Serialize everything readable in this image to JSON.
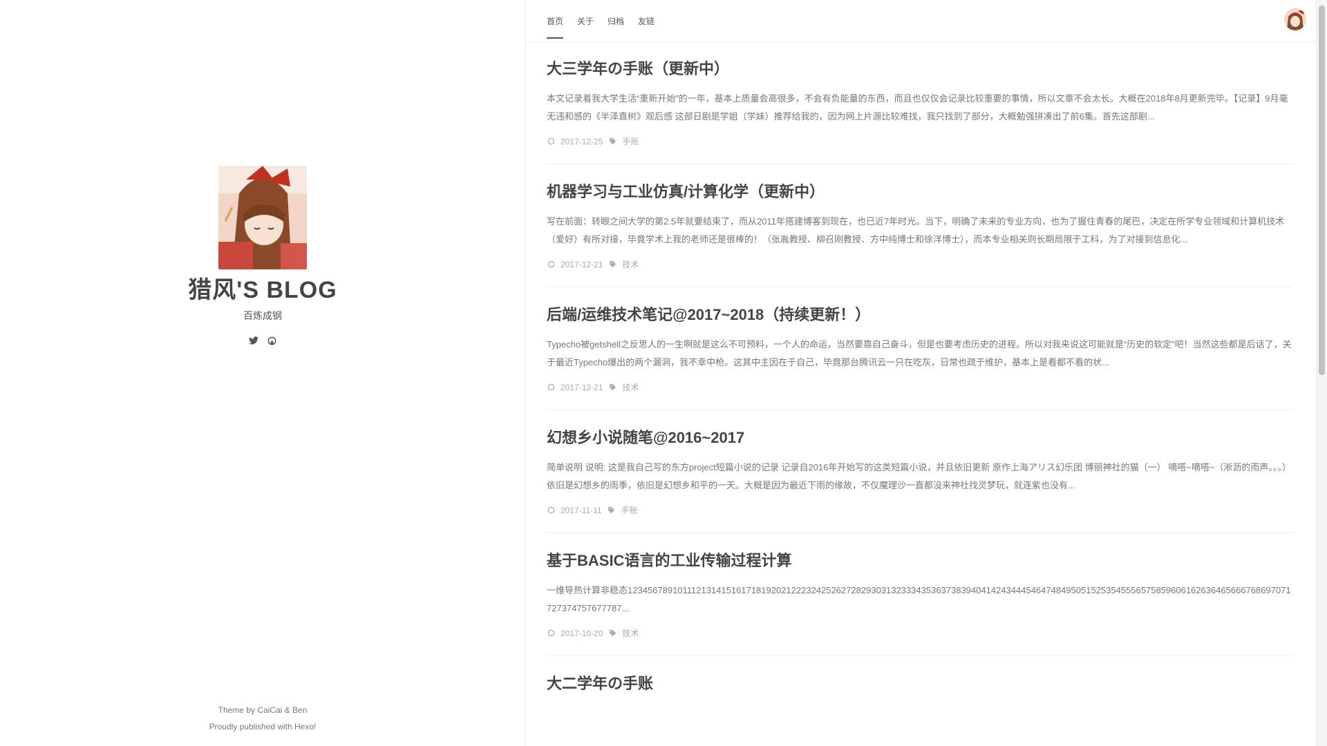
{
  "sidebar": {
    "title": "猎风'S BLOG",
    "subtitle": "百炼成钢",
    "social_icons": [
      "twitter-icon",
      "github-icon"
    ],
    "footer": {
      "line1": "Theme by CaiCai & Ben",
      "line2": "Proudly published with Hexo!"
    }
  },
  "nav": {
    "items": [
      {
        "label": "首页",
        "active": true
      },
      {
        "label": "关于"
      },
      {
        "label": "归档"
      },
      {
        "label": "友链"
      }
    ]
  },
  "posts": [
    {
      "title": "大三学年の手账（更新中）",
      "excerpt": "本文记录着我大学生活“重新开始”的一年，基本上质量会高很多，不会有负能量的东西，而且也仅仅会记录比较重要的事情，所以文章不会太长。大概在2018年8月更新完毕。【记录】9月毫无违和感的《半泽直树》观后感 这部日剧是学姐（学妹）推荐给我的，因为网上片源比较难找，我只找到了部分，大概勉强拼凑出了前6集。首先这部剧...",
      "date": "2017-12-25",
      "tag": "手账"
    },
    {
      "title": "机器学习与工业仿真/计算化学（更新中）",
      "excerpt": "写在前面：转眼之间大学的第2.5年就要结束了，而从2011年搭建博客到现在，也已近7年时光。当下，明确了未来的专业方向，也为了握住青春的尾巴，决定在所学专业领域和计算机技术（爱好）有所对接，毕竟学术上我的老师还是很棒的！（张胤教授、柳召刚教授、方中纯博士和徐洋博士），而本专业相关则长期局限于工科，为了对接到信息化...",
      "date": "2017-12-21",
      "tag": "技术"
    },
    {
      "title": "后端/运维技术笔记@2017~2018（持续更新！）",
      "excerpt": "Typecho被getshell之反思人的一生啊就是这么不可预料，一个人的命运，当然要靠自己奋斗，但是也要考虑历史的进程。所以对我来说这可能就是“历史的软定”吧！当然这些都是后话了，关于最近Typecho爆出的两个漏洞，我不幸中枪。这其中主因在于自己，毕竟那台腾讯云一只在吃灰，日常也疏于维护，基本上是看都不看的状...",
      "date": "2017-12-21",
      "tag": "技术"
    },
    {
      "title": "幻想乡小说随笔@2016~2017",
      "excerpt": "简单说明 说明: 这是我自己写的东方project短篇小说的记录 记录自2016年开始写的这类短篇小说，并且依旧更新 原作上海アリス幻乐团 博丽神社的猫（一） 嘀嗒~嘀嗒~（淅沥的雨声。。。）依旧是幻想乡的雨季，依旧是幻想乡和平的一天。大概是因为最近下雨的缘故，不仅魔理沙一直都没来神社找灵梦玩，就连紫也没有...",
      "date": "2017-11-11",
      "tag": "手账"
    },
    {
      "title": "基于BASIC语言的工业传输过程计算",
      "excerpt": "一维导热计算非稳态1234567891011121314151617181920212223242526272829303132333435363738394041424344454647484950515253545556575859606162636465666768697071727374757677787...",
      "date": "2017-10-20",
      "tag": "技术"
    },
    {
      "title": "大二学年の手账",
      "excerpt": "",
      "date": "",
      "tag": ""
    }
  ],
  "colors": {
    "title": "#444444",
    "text": "#777777",
    "meta": "#aaaaaa",
    "divider": "#eeeeee"
  }
}
